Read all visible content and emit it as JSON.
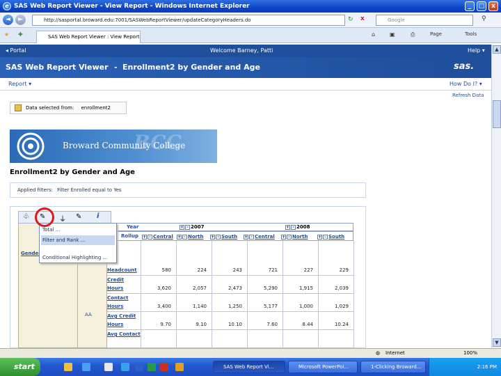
{
  "window": {
    "title": "SAS Web Report Viewer - View Report - Windows Internet Explorer",
    "minimize": "_",
    "maximize": "□",
    "close": "x"
  },
  "browser": {
    "back": "◄",
    "forward": "►",
    "address": "http://sasportal.broward.edu:7001/SASWebReportViewer/updateCategoryHeaders.do",
    "refresh": "↻",
    "stop": "x",
    "search_placeholder": "Google",
    "tab_label": "SAS Web Report Viewer : View Report",
    "page_menu": "Page",
    "tools_menu": "Tools"
  },
  "sas": {
    "portal_link": "◂ Portal",
    "welcome": "Welcome Barney, Patti",
    "help": "Help ▾",
    "app_title": "SAS Web Report Viewer",
    "separator": "-",
    "report_name": "Enrollment2 by Gender and Age",
    "brand": "sas.",
    "report_menu": "Report ▾",
    "how_do_i": "How Do I? ▾",
    "refresh_data": "Refresh Data"
  },
  "content": {
    "data_selected_label": "Data selected from:",
    "data_selected_value": "enrollment2",
    "logo_text": "Broward Community College",
    "logo_watermark": "BCC",
    "report_title": "Enrollment2 by Gender and Age",
    "filters_label": "Applied filters:",
    "filters_value": "Filter Enrolled equal to Yes"
  },
  "toolbar_menu": {
    "items": [
      "Total ...",
      "Filter and Rank ...",
      "Conditional Highlighting ..."
    ]
  },
  "crosstab": {
    "year_header": "Year",
    "rollup_header": "Rollup",
    "gender_label": "Gender",
    "age_marker": "AA",
    "years": [
      "2007",
      "2008"
    ],
    "regions": [
      "Central",
      "North",
      "South",
      "Central",
      "North",
      "South"
    ],
    "measures": [
      {
        "label": "Headcount",
        "values": [
          "580",
          "224",
          "243",
          "721",
          "227",
          "229"
        ]
      },
      {
        "label": "Credit Hours",
        "values": [
          "3,620",
          "2,057",
          "2,473",
          "5,290",
          "1,915",
          "2,039"
        ]
      },
      {
        "label": "Contact Hours",
        "values": [
          "3,400",
          "1,140",
          "1,250",
          "5,177",
          "1,000",
          "1,029"
        ]
      },
      {
        "label": "Avg Credit Hours",
        "values": [
          "9.70",
          "9.10",
          "10.10",
          "7.60",
          "8.44",
          "10.24"
        ]
      },
      {
        "label": "Avg Contact",
        "values": [
          "",
          "",
          "",
          "",
          "",
          ""
        ]
      }
    ]
  },
  "statusbar": {
    "zone": "Internet",
    "zoom": "100%"
  },
  "taskbar": {
    "start": "start",
    "buttons": [
      "SAS Web Report Vi...",
      "Microsoft PowerPoi...",
      "1-Clicking Broward..."
    ],
    "clock": "2:16 PM"
  }
}
